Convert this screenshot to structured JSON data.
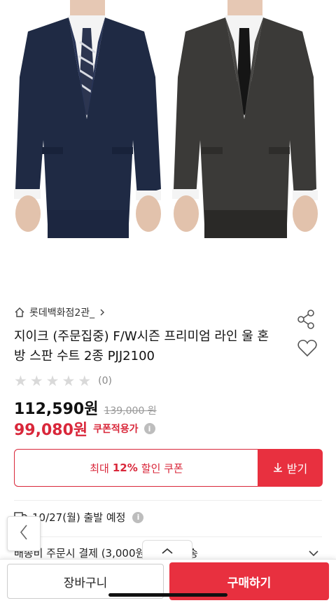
{
  "product": {
    "store": "롯데백화점2관_",
    "title": "지이크 (주문집중) F/W시즌 프리미엄 라인 울 혼방 스판 수트 2종 PJJ2100",
    "rating_count": "(0)",
    "price": "112,590원",
    "original_price": "139,000 원",
    "sale_price": "99,080원",
    "sale_label": "쿠폰적용가",
    "rating_stars": 0
  },
  "coupon": {
    "prefix": "최대",
    "percent": "12%",
    "suffix": "할인 쿠폰",
    "button_label": "받기"
  },
  "shipping": {
    "date_text": "10/27(월) 출발 예정",
    "fee_text": "배송비 주문시 결제 (3,000원) | 국제특송"
  },
  "bottom": {
    "cart_label": "장바구니",
    "buy_label": "구매하기"
  },
  "icons": {
    "info": "i"
  },
  "colors": {
    "accent": "#e8303f",
    "sale": "#d9273a"
  }
}
